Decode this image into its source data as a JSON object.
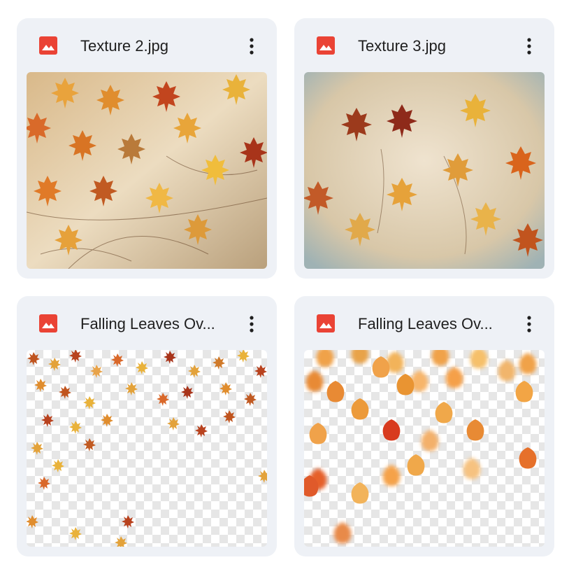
{
  "files": [
    {
      "name": "Texture 2.jpg",
      "icon": "image-file-icon",
      "preview": "autumn-leaves-texture"
    },
    {
      "name": "Texture 3.jpg",
      "icon": "image-file-icon",
      "preview": "autumn-leaves-texture"
    },
    {
      "name": "Falling Leaves Ov...",
      "icon": "image-file-icon",
      "preview": "falling-leaves-transparent"
    },
    {
      "name": "Falling Leaves Ov...",
      "icon": "image-file-icon",
      "preview": "falling-leaves-blurred-transparent"
    }
  ],
  "colors": {
    "card_bg": "#eef1f6",
    "icon_red": "#ea4335",
    "text": "#1f1f1f",
    "leaf_orange": "#e0872a",
    "leaf_red": "#b8421e",
    "leaf_yellow": "#e9b23a"
  },
  "more_icon": "more-vert-icon"
}
